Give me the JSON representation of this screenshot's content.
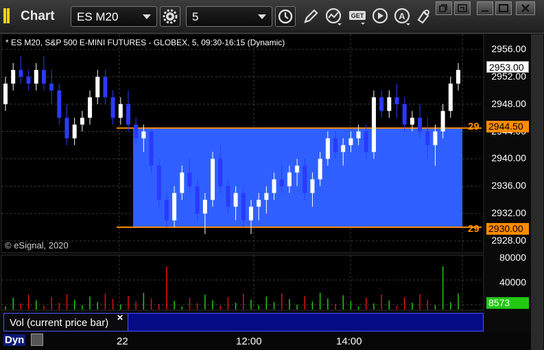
{
  "window": {
    "title": "Chart"
  },
  "toolbar": {
    "symbol": "ES M20",
    "interval": "5",
    "icons": [
      "gear-icon",
      "clock-icon",
      "pencil-icon",
      "indicator-icon",
      "get-icon",
      "play-icon",
      "alert-icon",
      "cursor-icon"
    ]
  },
  "window_controls": [
    "restore-icon",
    "popout-icon",
    "minimize-icon",
    "maximize-icon",
    "close-icon"
  ],
  "chart": {
    "subtitle": "* ES M20, S&P 500 E-MINI FUTURES - GLOBEX, 5, 09:30-16:15 (Dynamic)",
    "copyright": "© eSignal, 2020",
    "price_axis": [
      "2956.00",
      "2952.00",
      "2948.00",
      "2944.00",
      "2940.00",
      "2936.00",
      "2932.00",
      "2928.00"
    ],
    "last_price": "2953.00",
    "upper_level_flag": "2944.50",
    "lower_level_flag": "2930.00",
    "upper_level_tag": "29",
    "lower_level_tag": "29",
    "volume_axis": [
      "80000",
      "40000",
      "0"
    ],
    "volume_flag": "8573",
    "volume_study_label": "Vol (current price bar)",
    "time_axis": [
      "22",
      "12:00",
      "14:00"
    ],
    "dyn_label": "Dyn",
    "colors": {
      "up_bar": "#ffffff",
      "down_bar": "#2a3aff",
      "range_box": "#2f60ff",
      "level_line": "#ff8c00",
      "vol_up": "#22c811",
      "vol_down": "#e01010"
    }
  },
  "chart_data": {
    "type": "candlestick",
    "title": "ES M20, S&P 500 E-MINI FUTURES - GLOBEX, 5, 09:30-16:15 (Dynamic)",
    "ylim": [
      2927,
      2957
    ],
    "levels": [
      2944.5,
      2930.0
    ],
    "last": 2953.0,
    "ohlc": [
      [
        2948,
        2952,
        2947,
        2951
      ],
      [
        2951,
        2954,
        2950,
        2953
      ],
      [
        2953,
        2955,
        2951,
        2952
      ],
      [
        2952,
        2953,
        2950,
        2951
      ],
      [
        2951,
        2954,
        2950,
        2953
      ],
      [
        2953,
        2955,
        2950,
        2951
      ],
      [
        2951,
        2953,
        2948,
        2950
      ],
      [
        2950,
        2951,
        2945,
        2946
      ],
      [
        2946,
        2948,
        2942,
        2943
      ],
      [
        2943,
        2946,
        2942,
        2945
      ],
      [
        2945,
        2947,
        2944,
        2946
      ],
      [
        2946,
        2950,
        2945,
        2949
      ],
      [
        2949,
        2953,
        2948,
        2952
      ],
      [
        2952,
        2953,
        2948,
        2949
      ],
      [
        2949,
        2950,
        2945,
        2946
      ],
      [
        2946,
        2949,
        2945,
        2948
      ],
      [
        2948,
        2950,
        2944,
        2945
      ],
      [
        2945,
        2946,
        2942,
        2943
      ],
      [
        2943,
        2945,
        2941,
        2944
      ],
      [
        2944,
        2944,
        2938,
        2939
      ],
      [
        2939,
        2940,
        2933,
        2934
      ],
      [
        2934,
        2935,
        2930,
        2931
      ],
      [
        2931,
        2936,
        2930,
        2935
      ],
      [
        2935,
        2939,
        2934,
        2938
      ],
      [
        2938,
        2940,
        2935,
        2936
      ],
      [
        2936,
        2937,
        2931,
        2932
      ],
      [
        2932,
        2935,
        2929,
        2934
      ],
      [
        2934,
        2941,
        2933,
        2940
      ],
      [
        2940,
        2942,
        2935,
        2936
      ],
      [
        2936,
        2937,
        2932,
        2933
      ],
      [
        2933,
        2936,
        2931,
        2935
      ],
      [
        2935,
        2936,
        2930,
        2931
      ],
      [
        2931,
        2934,
        2929,
        2933
      ],
      [
        2933,
        2935,
        2931,
        2934
      ],
      [
        2934,
        2936,
        2932,
        2935
      ],
      [
        2935,
        2938,
        2934,
        2937
      ],
      [
        2937,
        2939,
        2935,
        2936
      ],
      [
        2936,
        2939,
        2935,
        2938
      ],
      [
        2938,
        2940,
        2936,
        2939
      ],
      [
        2939,
        2940,
        2934,
        2935
      ],
      [
        2935,
        2938,
        2933,
        2937
      ],
      [
        2937,
        2941,
        2936,
        2940
      ],
      [
        2940,
        2944,
        2939,
        2943
      ],
      [
        2943,
        2944,
        2940,
        2941
      ],
      [
        2941,
        2943,
        2939,
        2942
      ],
      [
        2942,
        2944,
        2941,
        2943
      ],
      [
        2943,
        2945,
        2942,
        2944
      ],
      [
        2944,
        2945,
        2940,
        2941
      ],
      [
        2941,
        2950,
        2940,
        2949
      ],
      [
        2949,
        2950,
        2946,
        2947
      ],
      [
        2947,
        2950,
        2946,
        2949
      ],
      [
        2949,
        2951,
        2946,
        2948
      ],
      [
        2948,
        2949,
        2944,
        2945
      ],
      [
        2945,
        2947,
        2944,
        2946
      ],
      [
        2946,
        2948,
        2943,
        2944
      ],
      [
        2944,
        2946,
        2940,
        2942
      ],
      [
        2942,
        2945,
        2939,
        2944
      ],
      [
        2944,
        2948,
        2943,
        2947
      ],
      [
        2947,
        2952,
        2946,
        2951
      ],
      [
        2951,
        2954,
        2950,
        2953
      ]
    ]
  }
}
